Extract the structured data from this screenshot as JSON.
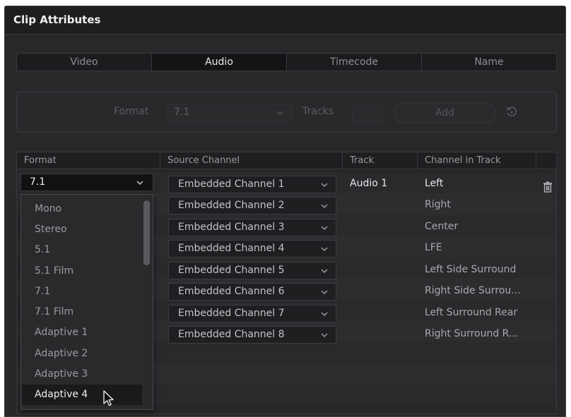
{
  "window": {
    "title": "Clip Attributes"
  },
  "tabs": [
    {
      "label": "Video",
      "active": false
    },
    {
      "label": "Audio",
      "active": true
    },
    {
      "label": "Timecode",
      "active": false
    },
    {
      "label": "Name",
      "active": false
    }
  ],
  "format_bar": {
    "format_label": "Format",
    "format_value": "7.1",
    "tracks_label": "Tracks",
    "tracks_value": "",
    "add_label": "Add",
    "reset_icon": "reset-icon"
  },
  "table": {
    "columns": [
      "Format",
      "Source Channel",
      "Track",
      "Channel in Track"
    ],
    "format_value": "7.1",
    "track_value": "Audio 1",
    "rows": [
      {
        "source": "Embedded Channel 1",
        "channel": "Left"
      },
      {
        "source": "Embedded Channel 2",
        "channel": "Right"
      },
      {
        "source": "Embedded Channel 3",
        "channel": "Center"
      },
      {
        "source": "Embedded Channel 4",
        "channel": "LFE"
      },
      {
        "source": "Embedded Channel 5",
        "channel": "Left Side Surround"
      },
      {
        "source": "Embedded Channel 6",
        "channel": "Right Side Surrou..."
      },
      {
        "source": "Embedded Channel 7",
        "channel": "Left Surround Rear"
      },
      {
        "source": "Embedded Channel 8",
        "channel": "Right Surround R..."
      }
    ]
  },
  "format_dropdown": {
    "options": [
      "Mono",
      "Stereo",
      "5.1",
      "5.1 Film",
      "7.1",
      "7.1 Film",
      "Adaptive 1",
      "Adaptive 2",
      "Adaptive 3",
      "Adaptive 4"
    ],
    "highlighted": "Adaptive 4"
  },
  "colors": {
    "panel_bg": "#28282b",
    "title_bar": "#1e1e21",
    "active_tab": "#141416",
    "text_bright": "#e8e8ec",
    "text_dim": "#5f5f63"
  }
}
